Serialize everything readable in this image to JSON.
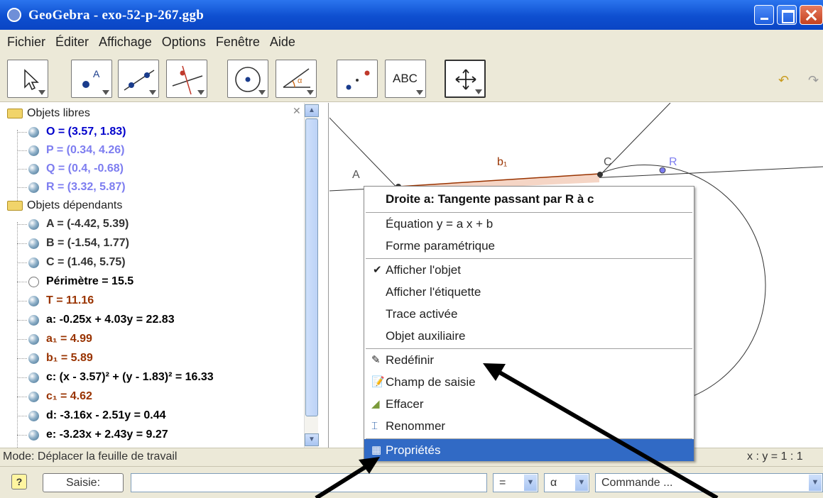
{
  "window": {
    "title": "GeoGebra - exo-52-p-267.ggb"
  },
  "menubar": {
    "items": [
      "Fichier",
      "Éditer",
      "Affichage",
      "Options",
      "Fenêtre",
      "Aide"
    ]
  },
  "toolbar": {
    "abc_label": "ABC"
  },
  "algebra": {
    "free_folder": "Objets libres",
    "free": [
      {
        "text": "O = (3.57, 1.83)",
        "color": "#0000cc"
      },
      {
        "text": "P = (0.34, 4.26)",
        "color": "#7d7df0"
      },
      {
        "text": "Q = (0.4, -0.68)",
        "color": "#7d7df0"
      },
      {
        "text": "R = (3.32, 5.87)",
        "color": "#7d7df0"
      }
    ],
    "dep_folder": "Objets dépendants",
    "dependent": [
      {
        "text": "A = (-4.42, 5.39)",
        "color": "#333333"
      },
      {
        "text": "B = (-1.54, 1.77)",
        "color": "#333333"
      },
      {
        "text": "C = (1.46, 5.75)",
        "color": "#333333"
      },
      {
        "text": "Périmètre = 15.5",
        "color": "#000000",
        "hollow": true
      },
      {
        "text": "T = 11.16",
        "color": "#993300"
      },
      {
        "text": "a: -0.25x + 4.03y = 22.83",
        "color": "#000000"
      },
      {
        "text": "a₁ = 4.99",
        "color": "#993300"
      },
      {
        "text": "b₁ = 5.89",
        "color": "#993300"
      },
      {
        "text": "c: (x - 3.57)² + (y - 1.83)² = 16.33",
        "color": "#000000"
      },
      {
        "text": "c₁ = 4.62",
        "color": "#993300"
      },
      {
        "text": "d: -3.16x - 2.51y = 0.44",
        "color": "#000000"
      },
      {
        "text": "e: -3.23x + 2.43y = 9.27",
        "color": "#000000"
      }
    ]
  },
  "graphics": {
    "label_A": "A",
    "label_b1": "b₁",
    "label_C": "C",
    "label_R": "R"
  },
  "context_menu": {
    "title": "Droite a: Tangente passant par R à c",
    "items": {
      "equation": "Équation y = a x + b",
      "parametric": "Forme paramétrique",
      "show_object": "Afficher l'objet",
      "show_label": "Afficher l'étiquette",
      "trace": "Trace activée",
      "auxiliary": "Objet auxiliaire",
      "redefine": "Redéfinir",
      "input_field": "Champ de saisie",
      "delete": "Effacer",
      "rename": "Renommer",
      "properties": "Propriétés"
    }
  },
  "status": {
    "mode": "Mode: Déplacer la feuille de travail",
    "ratio": "x : y = 1 : 1"
  },
  "inputbar": {
    "help": "?",
    "saisie_label": "Saisie:",
    "input_value": "",
    "equal_value": "=",
    "alpha_value": "α",
    "command_value": "Commande ..."
  },
  "colors": {
    "titlebar": "#0e4fd0",
    "highlight": "#316ac5",
    "free_point": "#0000cc",
    "number": "#993300"
  }
}
